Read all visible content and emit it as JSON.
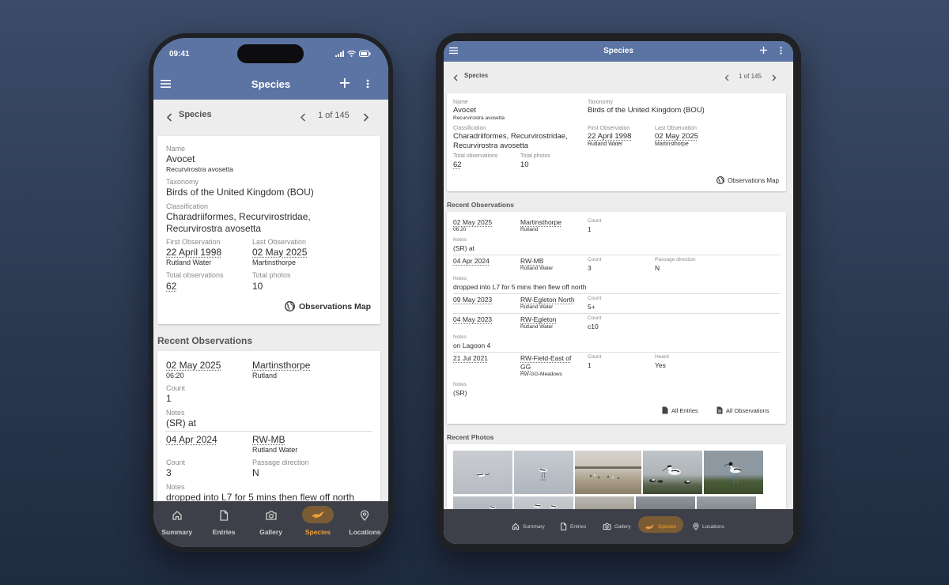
{
  "app": {
    "title": "Species"
  },
  "status_bar": {
    "time": "09:41"
  },
  "record_nav": {
    "back_label": "Species",
    "position": "1 of 145"
  },
  "species": {
    "name_label": "Name",
    "name": "Avocet",
    "scientific": "Recurvirostra avosetta",
    "taxonomy_label": "Taxonomy",
    "taxonomy": "Birds of the United Kingdom (BOU)",
    "classification_label": "Classification",
    "classification_line1": "Charadriiformes, Recurvirostridae,",
    "classification_line2": "Recurvirostra avosetta",
    "first_obs_label": "First Observation",
    "first_obs_date": "22 April 1998",
    "first_obs_place": "Rutland Water",
    "last_obs_label": "Last Observation",
    "last_obs_date": "02 May 2025",
    "last_obs_place": "Martinsthorpe",
    "total_obs_label": "Total observations",
    "total_obs": "62",
    "total_photos_label": "Total photos",
    "total_photos": "10",
    "map_button": "Observations Map"
  },
  "recent_observations": {
    "title": "Recent Observations",
    "count_label": "Count",
    "notes_label": "Notes",
    "passage_label": "Passage direction",
    "heard_label": "Heard",
    "items": [
      {
        "date": "02 May 2025",
        "time": "06:20",
        "location": "Martinsthorpe",
        "region": "Rutland",
        "count": "1",
        "notes": "(SR) at"
      },
      {
        "date": "04 Apr 2024",
        "location": "RW-MB",
        "region": "Rutland Water",
        "count": "3",
        "passage": "N",
        "notes": "dropped into L7 for 5 mins then flew off north"
      },
      {
        "date": "09 May 2023",
        "location": "RW-Egleton North",
        "region": "Rutland Water",
        "count": "5+"
      },
      {
        "date": "04 May 2023",
        "location": "RW-Egleton",
        "region": "Rutland Water",
        "count": "c10",
        "notes": "on Lagoon 4"
      },
      {
        "date": "21 Jul 2021",
        "location_line1": "RW-Field-East of",
        "location_line2": "GG",
        "region": "RW-GG-Meadows",
        "count": "1",
        "heard": "Yes",
        "notes": "(SR)"
      }
    ],
    "all_entries": "All Entries",
    "all_observations": "All Observations"
  },
  "recent_photos": {
    "title": "Recent Photos"
  },
  "bottom_nav": {
    "items": [
      {
        "label": "Summary",
        "icon": "home-icon"
      },
      {
        "label": "Entries",
        "icon": "document-icon"
      },
      {
        "label": "Gallery",
        "icon": "camera-icon"
      },
      {
        "label": "Species",
        "icon": "bird-icon",
        "active": true
      },
      {
        "label": "Locations",
        "icon": "location-pin-icon"
      }
    ]
  },
  "colors": {
    "app_bar": "#5b74a3",
    "nav_bar": "#3d4049",
    "active": "#f0a23a",
    "active_pill": "#7a5c34"
  }
}
